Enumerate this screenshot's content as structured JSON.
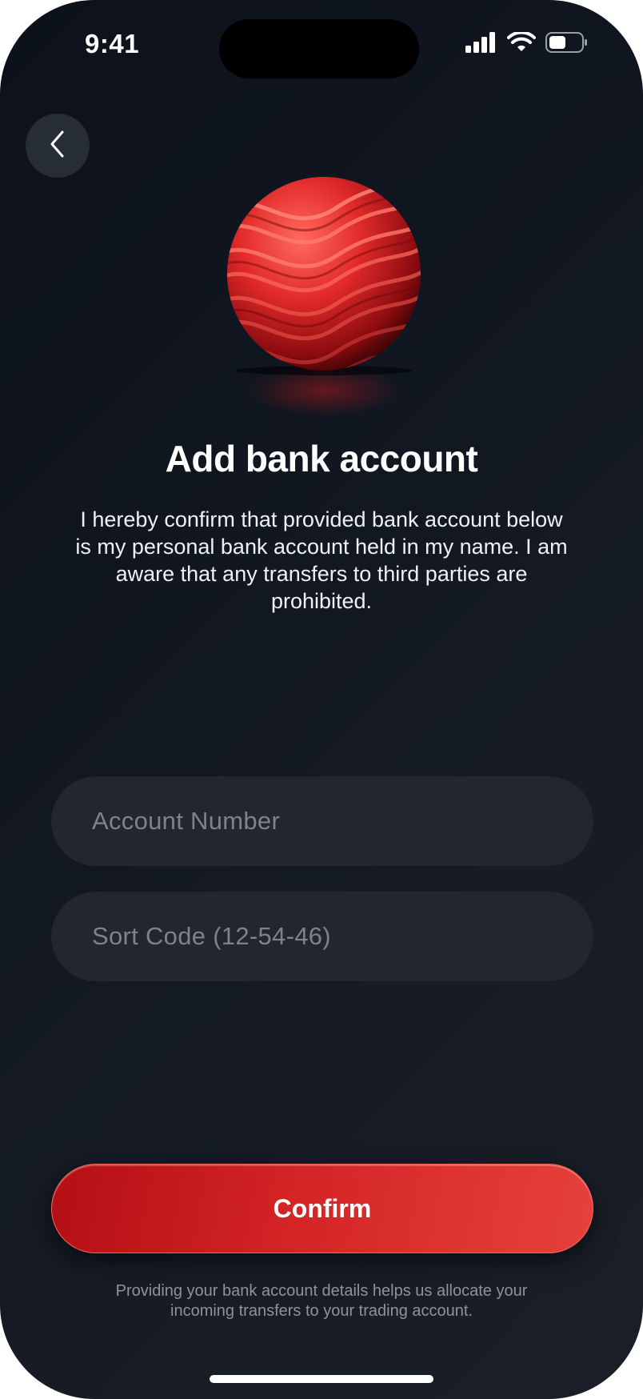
{
  "status_bar": {
    "time": "9:41"
  },
  "header": {
    "back_icon": "chevron-left-icon"
  },
  "hero": {
    "image": "red-swirl-sphere",
    "accent_color": "#e03030"
  },
  "content": {
    "title": "Add bank account",
    "description": "I hereby confirm that provided bank account below is my personal bank account held in my name. I am aware that any transfers to third parties are prohibited."
  },
  "form": {
    "account_number": {
      "value": "",
      "placeholder": "Account Number"
    },
    "sort_code": {
      "value": "",
      "placeholder": "Sort Code (12-54-46)"
    }
  },
  "actions": {
    "confirm_label": "Confirm",
    "confirm_color": "#d42426"
  },
  "footer": {
    "note": "Providing your bank account details helps us allocate your incoming transfers to your trading account."
  }
}
